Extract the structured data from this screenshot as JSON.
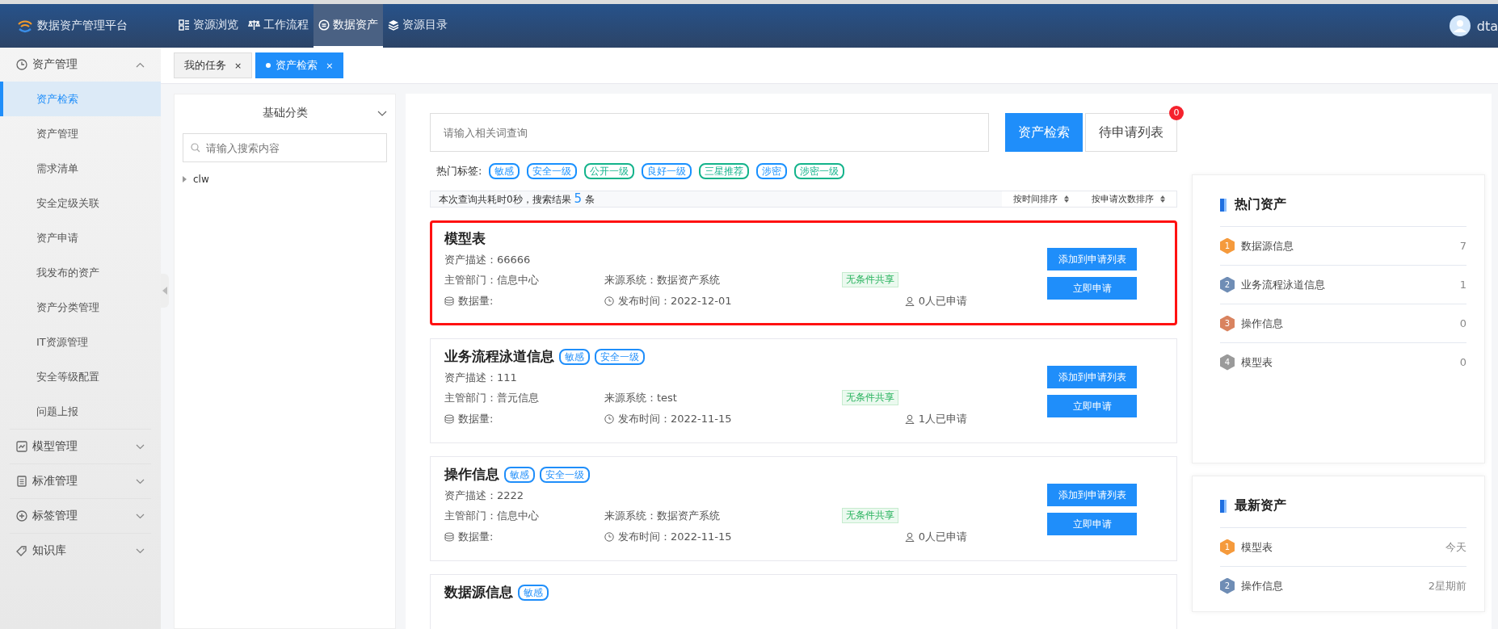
{
  "header": {
    "logo_text": "数据资产管理平台",
    "nav": [
      {
        "label": "资源浏览",
        "selected": false
      },
      {
        "label": "工作流程",
        "selected": false
      },
      {
        "label": "数据资产",
        "selected": true
      },
      {
        "label": "资源目录",
        "selected": false
      }
    ],
    "user": "dta"
  },
  "sidebar": {
    "groups": [
      {
        "label": "资产管理",
        "expanded": true,
        "children": [
          {
            "label": "资产检索",
            "selected": true
          },
          {
            "label": "资产管理",
            "selected": false
          },
          {
            "label": "需求清单",
            "selected": false
          },
          {
            "label": "安全定级关联",
            "selected": false
          },
          {
            "label": "资产申请",
            "selected": false
          },
          {
            "label": "我发布的资产",
            "selected": false
          },
          {
            "label": "资产分类管理",
            "selected": false
          },
          {
            "label": "IT资源管理",
            "selected": false
          },
          {
            "label": "安全等级配置",
            "selected": false
          },
          {
            "label": "问题上报",
            "selected": false
          }
        ]
      },
      {
        "label": "模型管理",
        "expanded": false
      },
      {
        "label": "标准管理",
        "expanded": false
      },
      {
        "label": "标签管理",
        "expanded": false
      },
      {
        "label": "知识库",
        "expanded": false
      }
    ]
  },
  "tabs": [
    {
      "label": "我的任务",
      "selected": false,
      "close": "×"
    },
    {
      "label": "资产检索",
      "selected": true,
      "close": "×"
    }
  ],
  "category_panel": {
    "title": "基础分类",
    "search": {
      "placeholder": "请输入搜索内容"
    },
    "tree": [
      {
        "label": "clw",
        "expanded": false
      }
    ]
  },
  "search": {
    "placeholder": "请输入相关词查询",
    "search_button": "资产检索",
    "pending_button": "待申请列表",
    "pending_count": "0"
  },
  "hot_tags": {
    "label": "热门标签:",
    "tags": [
      {
        "label": "敏感",
        "color": "#1890ff"
      },
      {
        "label": "安全一级",
        "color": "#1890ff"
      },
      {
        "label": "公开一级",
        "color": "#13b38b"
      },
      {
        "label": "良好一级",
        "color": "#1890ff"
      },
      {
        "label": "三星推荐",
        "color": "#13b38b"
      },
      {
        "label": "涉密",
        "color": "#1890ff"
      },
      {
        "label": "涉密一级",
        "color": "#13b38b"
      }
    ]
  },
  "result_bar": {
    "prefix": "本次查询共耗时0秒，搜索结果",
    "count": "5",
    "suffix": "条",
    "sorts": [
      "按时间排序",
      "按申请次数排序"
    ]
  },
  "results": [
    {
      "title": "模型表",
      "highlighted": true,
      "description": "资产描述：66666",
      "department": "主管部门：信息中心",
      "source": "来源系统：数据资产系统",
      "share": "无条件共享",
      "volume": "数据量:",
      "published": "发布时间：2022-12-01",
      "applicants": "0人已申请",
      "add_button": "添加到申请列表",
      "apply_button": "立即申请"
    },
    {
      "title": "业务流程泳道信息",
      "tags": [
        "敏感",
        "安全一级"
      ],
      "highlighted": false,
      "description": "资产描述：111",
      "department": "主管部门：普元信息",
      "source": "来源系统：test",
      "share": "无条件共享",
      "volume": "数据量:",
      "published": "发布时间：2022-11-15",
      "applicants": "1人已申请",
      "add_button": "添加到申请列表",
      "apply_button": "立即申请"
    },
    {
      "title": "操作信息",
      "tags": [
        "敏感",
        "安全一级"
      ],
      "highlighted": false,
      "description": "资产描述：2222",
      "department": "主管部门：信息中心",
      "source": "来源系统：数据资产系统",
      "share": "无条件共享",
      "volume": "数据量:",
      "published": "发布时间：2022-11-15",
      "applicants": "0人已申请",
      "add_button": "添加到申请列表",
      "apply_button": "立即申请"
    },
    {
      "title": "数据源信息",
      "tags": [
        "敏感"
      ],
      "highlighted": false
    }
  ],
  "hot_assets": {
    "title": "热门资产",
    "items": [
      {
        "rank": "1",
        "name": "数据源信息",
        "value": "7",
        "color": "#f59a3c"
      },
      {
        "rank": "2",
        "name": "业务流程泳道信息",
        "value": "1",
        "color": "#6f8db5"
      },
      {
        "rank": "3",
        "name": "操作信息",
        "value": "0",
        "color": "#d9835f"
      },
      {
        "rank": "4",
        "name": "模型表",
        "value": "0",
        "color": "#9a9a9a"
      }
    ]
  },
  "latest_assets": {
    "title": "最新资产",
    "items": [
      {
        "rank": "1",
        "name": "模型表",
        "value": "今天",
        "color": "#f59a3c"
      },
      {
        "rank": "2",
        "name": "操作信息",
        "value": "2星期前",
        "color": "#6f8db5"
      }
    ]
  }
}
